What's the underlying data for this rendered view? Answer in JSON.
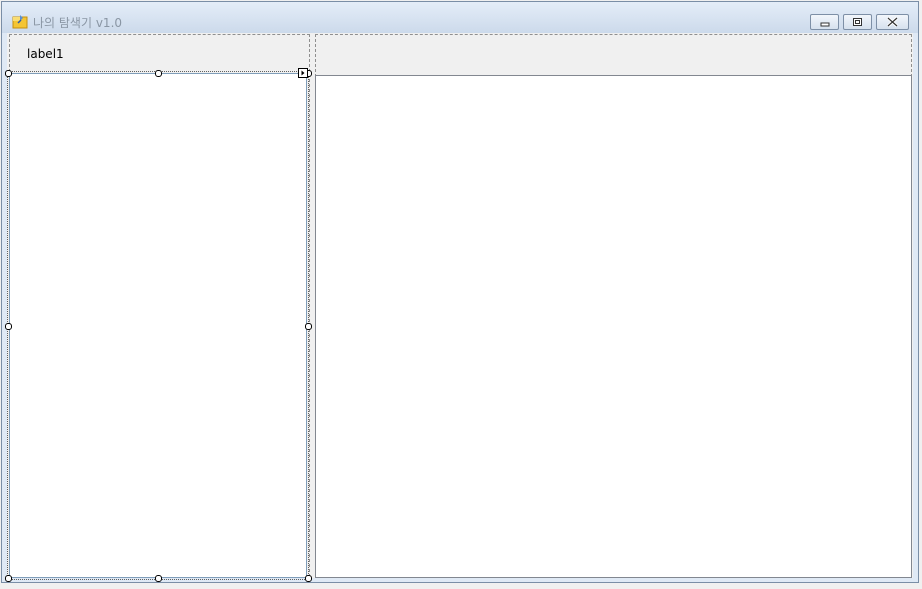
{
  "window": {
    "title": "나의 탐색기 v1.0",
    "icon": "form-icon"
  },
  "caption_buttons": {
    "minimize": "minimize-icon",
    "maximize": "maximize-icon",
    "close": "close-icon"
  },
  "left_panel": {
    "label": "label1"
  },
  "colors": {
    "titlebar": "#ccdaeb",
    "border": "#7a8ea6",
    "client": "#f0f0f0",
    "list_background": "#ffffff"
  }
}
